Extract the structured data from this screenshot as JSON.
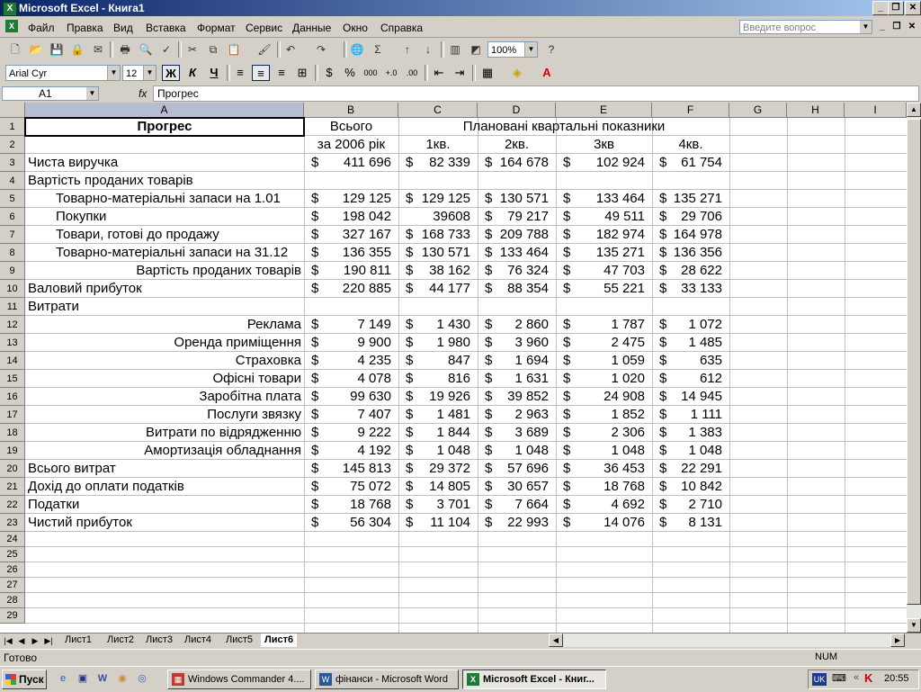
{
  "window": {
    "title": "Microsoft Excel - Книга1",
    "min": "_",
    "max": "❐",
    "close": "✕"
  },
  "menu": {
    "items": [
      "Файл",
      "Правка",
      "Вид",
      "Вставка",
      "Формат",
      "Сервис",
      "Данные",
      "Окно",
      "Справка"
    ],
    "ask_placeholder": "Введите вопрос"
  },
  "toolbar": {
    "zoom": "100%",
    "sigma": "Σ"
  },
  "format": {
    "font": "Arial Cyr",
    "size": "12",
    "bold": "Ж",
    "italic": "К",
    "underline": "Ч",
    "percent": "%",
    "thousands": "000"
  },
  "formula": {
    "cell": "A1",
    "fx": "fx",
    "content": "Прогрес"
  },
  "columns": [
    "A",
    "B",
    "C",
    "D",
    "E",
    "F",
    "G",
    "H",
    "I"
  ],
  "rows": [
    "1",
    "2",
    "3",
    "4",
    "5",
    "6",
    "7",
    "8",
    "9",
    "10",
    "11",
    "12",
    "13",
    "14",
    "15",
    "16",
    "17",
    "18",
    "19",
    "20",
    "21",
    "22",
    "23",
    "24",
    "25",
    "26",
    "27",
    "28",
    "29"
  ],
  "sheet": {
    "title": "Прогрес",
    "total_header": "Всього",
    "total_sub": "за 2006 рік",
    "planned_header": "Плановані квартальні показники",
    "quarters": [
      "1кв.",
      "2кв.",
      "3кв",
      "4кв."
    ],
    "data_rows": [
      {
        "label": "Чиста виручка",
        "indent": "none",
        "b": "411 696",
        "c": "82 339",
        "d": "164 678",
        "e": "102 924",
        "f": "61 754"
      },
      {
        "label": "Вартість проданих товарів",
        "indent": "none",
        "b": "",
        "c": "",
        "d": "",
        "e": "",
        "f": ""
      },
      {
        "label": "Товарно-матеріальні запаси на 1.01",
        "indent": "indent",
        "b": "129 125",
        "c": "129 125",
        "d": "130 571",
        "e": "133 464",
        "f": "135 271"
      },
      {
        "label": "Покупки",
        "indent": "indent",
        "b": "198 042",
        "c": "39608",
        "d": "79 217",
        "e": "49 511",
        "f": "29 706",
        "c_nodollar": true
      },
      {
        "label": "Товари, готові до продажу",
        "indent": "indent",
        "b": "327 167",
        "c": "168 733",
        "d": "209 788",
        "e": "182 974",
        "f": "164 978"
      },
      {
        "label": "Товарно-матеріальні запаси на 31.12",
        "indent": "indent",
        "b": "136 355",
        "c": "130 571",
        "d": "133 464",
        "e": "135 271",
        "f": "136 356"
      },
      {
        "label": "Вартість проданих товарів",
        "indent": "right",
        "b": "190 811",
        "c": "38 162",
        "d": "76 324",
        "e": "47 703",
        "f": "28 622"
      },
      {
        "label": "Валовий прибуток",
        "indent": "none",
        "b": "220 885",
        "c": "44 177",
        "d": "88 354",
        "e": "55 221",
        "f": "33 133"
      },
      {
        "label": "Витрати",
        "indent": "none",
        "b": "",
        "c": "",
        "d": "",
        "e": "",
        "f": ""
      },
      {
        "label": "Реклама",
        "indent": "right",
        "b": "7 149",
        "c": "1 430",
        "d": "2 860",
        "e": "1 787",
        "f": "1 072"
      },
      {
        "label": "Оренда приміщення",
        "indent": "right",
        "b": "9 900",
        "c": "1 980",
        "d": "3 960",
        "e": "2 475",
        "f": "1 485"
      },
      {
        "label": "Страховка",
        "indent": "right",
        "b": "4 235",
        "c": "847",
        "d": "1 694",
        "e": "1 059",
        "f": "635"
      },
      {
        "label": "Офісні товари",
        "indent": "right",
        "b": "4 078",
        "c": "816",
        "d": "1 631",
        "e": "1 020",
        "f": "612"
      },
      {
        "label": "Заробітна плата",
        "indent": "right",
        "b": "99 630",
        "c": "19 926",
        "d": "39 852",
        "e": "24 908",
        "f": "14 945"
      },
      {
        "label": "Послуги звязку",
        "indent": "right",
        "b": "7 407",
        "c": "1 481",
        "d": "2 963",
        "e": "1 852",
        "f": "1 111"
      },
      {
        "label": "Витрати по відрядженню",
        "indent": "right",
        "b": "9 222",
        "c": "1 844",
        "d": "3 689",
        "e": "2 306",
        "f": "1 383"
      },
      {
        "label": "Амортизація обладнання",
        "indent": "right",
        "b": "4 192",
        "c": "1 048",
        "d": "1 048",
        "e": "1 048",
        "f": "1 048"
      },
      {
        "label": "Всього витрат",
        "indent": "none",
        "b": "145 813",
        "c": "29 372",
        "d": "57 696",
        "e": "36 453",
        "f": "22 291"
      },
      {
        "label": "Дохід до оплати податків",
        "indent": "none",
        "b": "75 072",
        "c": "14 805",
        "d": "30 657",
        "e": "18 768",
        "f": "10 842"
      },
      {
        "label": "Податки",
        "indent": "none",
        "b": "18 768",
        "c": "3 701",
        "d": "7 664",
        "e": "4 692",
        "f": "2 710"
      },
      {
        "label": "Чистий прибуток",
        "indent": "none",
        "b": "56 304",
        "c": "11 104",
        "d": "22 993",
        "e": "14 076",
        "f": "8 131"
      }
    ]
  },
  "tabs": [
    "Лист1",
    "Лист2",
    "Лист3",
    "Лист4",
    "Лист5",
    "Лист6"
  ],
  "active_tab": "Лист6",
  "status": {
    "left": "Готово",
    "num": "NUM"
  },
  "taskbar": {
    "start": "Пуск",
    "tasks": [
      "Windows Commander 4....",
      "фінанси - Microsoft Word",
      "Microsoft Excel - Книг..."
    ],
    "lang": "UK",
    "clock": "20:55"
  },
  "colors": {
    "title_start": "#0a246a",
    "title_end": "#a6caf0",
    "excel_green": "#1f7a3a",
    "selection_header": "#b6bdd2"
  }
}
